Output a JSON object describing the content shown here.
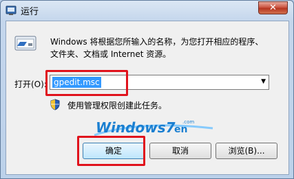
{
  "window": {
    "title": "运行",
    "close_glyph": "✕"
  },
  "dialog": {
    "description_line1": "Windows 将根据您所输入的名称，为您打开相应的程序、",
    "description_line2": "文件夹、文档或 Internet 资源。",
    "open_label": "打开(O):",
    "open_value": "gpedit.msc",
    "admin_note": "使用管理权限创建此任务。",
    "logo_text_main": "Windows7",
    "logo_text_suffix": "en",
    "logo_text_com": ".com"
  },
  "buttons": {
    "ok": "确定",
    "cancel": "取消",
    "browse": "浏览(B)..."
  },
  "colors": {
    "highlight": "#e0121c",
    "selection": "#3399ff",
    "logo_blue": "#1a7fd1",
    "logo_red": "#e0121c"
  }
}
